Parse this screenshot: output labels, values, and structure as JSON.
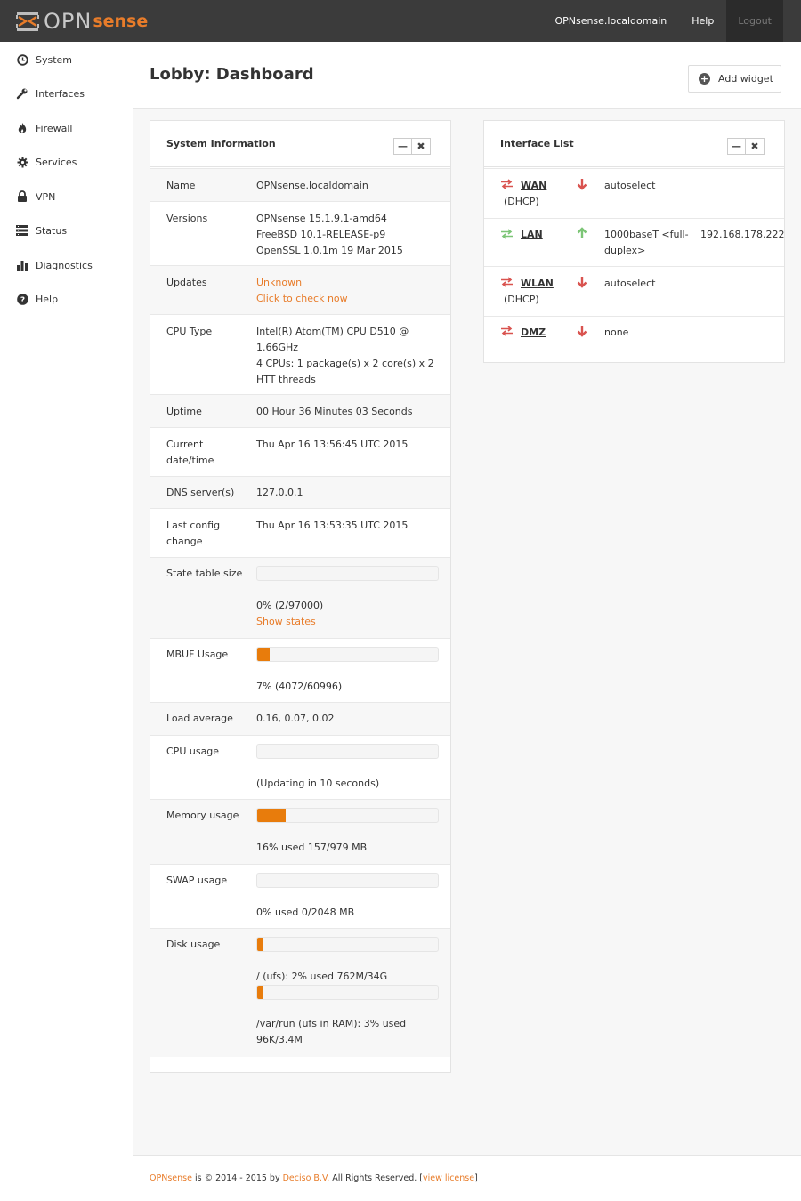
{
  "header": {
    "logo_opn": "OPN",
    "logo_sense": "sense",
    "nav": [
      {
        "label": "OPNsense.localdomain"
      },
      {
        "label": "Help"
      },
      {
        "label": "Logout"
      }
    ]
  },
  "sidebar": {
    "items": [
      {
        "label": "System",
        "icon": "clock-icon"
      },
      {
        "label": "Interfaces",
        "icon": "wrench-icon"
      },
      {
        "label": "Firewall",
        "icon": "fire-icon"
      },
      {
        "label": "Services",
        "icon": "gear-icon"
      },
      {
        "label": "VPN",
        "icon": "lock-icon"
      },
      {
        "label": "Status",
        "icon": "list-icon"
      },
      {
        "label": "Diagnostics",
        "icon": "bar-chart-icon"
      },
      {
        "label": "Help",
        "icon": "question-icon"
      }
    ]
  },
  "page": {
    "title": "Lobby: Dashboard",
    "add_widget": "Add widget"
  },
  "sysinfo": {
    "title": "System Information",
    "rows": {
      "name": {
        "label": "Name",
        "value": "OPNsense.localdomain"
      },
      "versions": {
        "label": "Versions",
        "lines": [
          "OPNsense 15.1.9.1-amd64",
          "FreeBSD 10.1-RELEASE-p9",
          "OpenSSL 1.0.1m 19 Mar 2015"
        ]
      },
      "updates": {
        "label": "Updates",
        "status": "Unknown",
        "link": "Click to check now"
      },
      "cpu_type": {
        "label": "CPU Type",
        "lines": [
          "Intel(R) Atom(TM) CPU D510 @",
          "1.66GHz",
          "4 CPUs: 1 package(s) x 2 core(s) x 2",
          "HTT threads"
        ]
      },
      "uptime": {
        "label": "Uptime",
        "value": "00 Hour 36 Minutes 03 Seconds"
      },
      "datetime": {
        "label_lines": [
          "Current",
          "date/time"
        ],
        "value": "Thu Apr 16 13:56:45 UTC 2015"
      },
      "dns": {
        "label": "DNS server(s)",
        "value": "127.0.0.1"
      },
      "lastconfig": {
        "label_lines": [
          "Last config",
          "change"
        ],
        "value": "Thu Apr 16 13:53:35 UTC 2015"
      },
      "state": {
        "label": "State table size",
        "percent": 0,
        "text": "0% (2/97000)",
        "link": "Show states"
      },
      "mbuf": {
        "label": "MBUF Usage",
        "percent": 7,
        "text": "7% (4072/60996)"
      },
      "load": {
        "label": "Load average",
        "value": "0.16, 0.07, 0.02"
      },
      "cpu": {
        "label": "CPU usage",
        "percent": 0,
        "text": "(Updating in 10 seconds)"
      },
      "memory": {
        "label": "Memory usage",
        "percent": 16,
        "text": "16% used 157/979 MB"
      },
      "swap": {
        "label": "SWAP usage",
        "percent": 0,
        "text": "0% used 0/2048 MB"
      },
      "disk": {
        "label": "Disk usage",
        "root_percent": 2,
        "root_text": "/ (ufs): 2% used 762M/34G",
        "varrun_percent": 3,
        "varrun_lines": [
          "/var/run (ufs in RAM): 3% used",
          "96K/3.4M"
        ]
      }
    }
  },
  "iflist": {
    "title": "Interface List",
    "rows": [
      {
        "name": "WAN",
        "sub": "(DHCP)",
        "status": "down",
        "media": "autoselect",
        "ip": ""
      },
      {
        "name": "LAN",
        "sub": "",
        "status": "up",
        "media_lines": [
          "1000baseT <full-",
          "duplex>"
        ],
        "ip": "192.168.178.222"
      },
      {
        "name": "WLAN",
        "sub": "(DHCP)",
        "status": "down",
        "media": "autoselect",
        "ip": ""
      },
      {
        "name": "DMZ",
        "sub": "",
        "status": "down",
        "media": "none",
        "ip": ""
      }
    ]
  },
  "footer": {
    "brand": "OPNsense",
    "text1": " is © 2014 - 2015 by ",
    "company": "Deciso B.V.",
    "text2": " All Rights Reserved. [",
    "license": "view license",
    "text3": "]"
  },
  "colors": {
    "accent": "#e87c0c",
    "topbar": "#3b3b3b",
    "down": "#d9534f",
    "up": "#7cc576"
  }
}
